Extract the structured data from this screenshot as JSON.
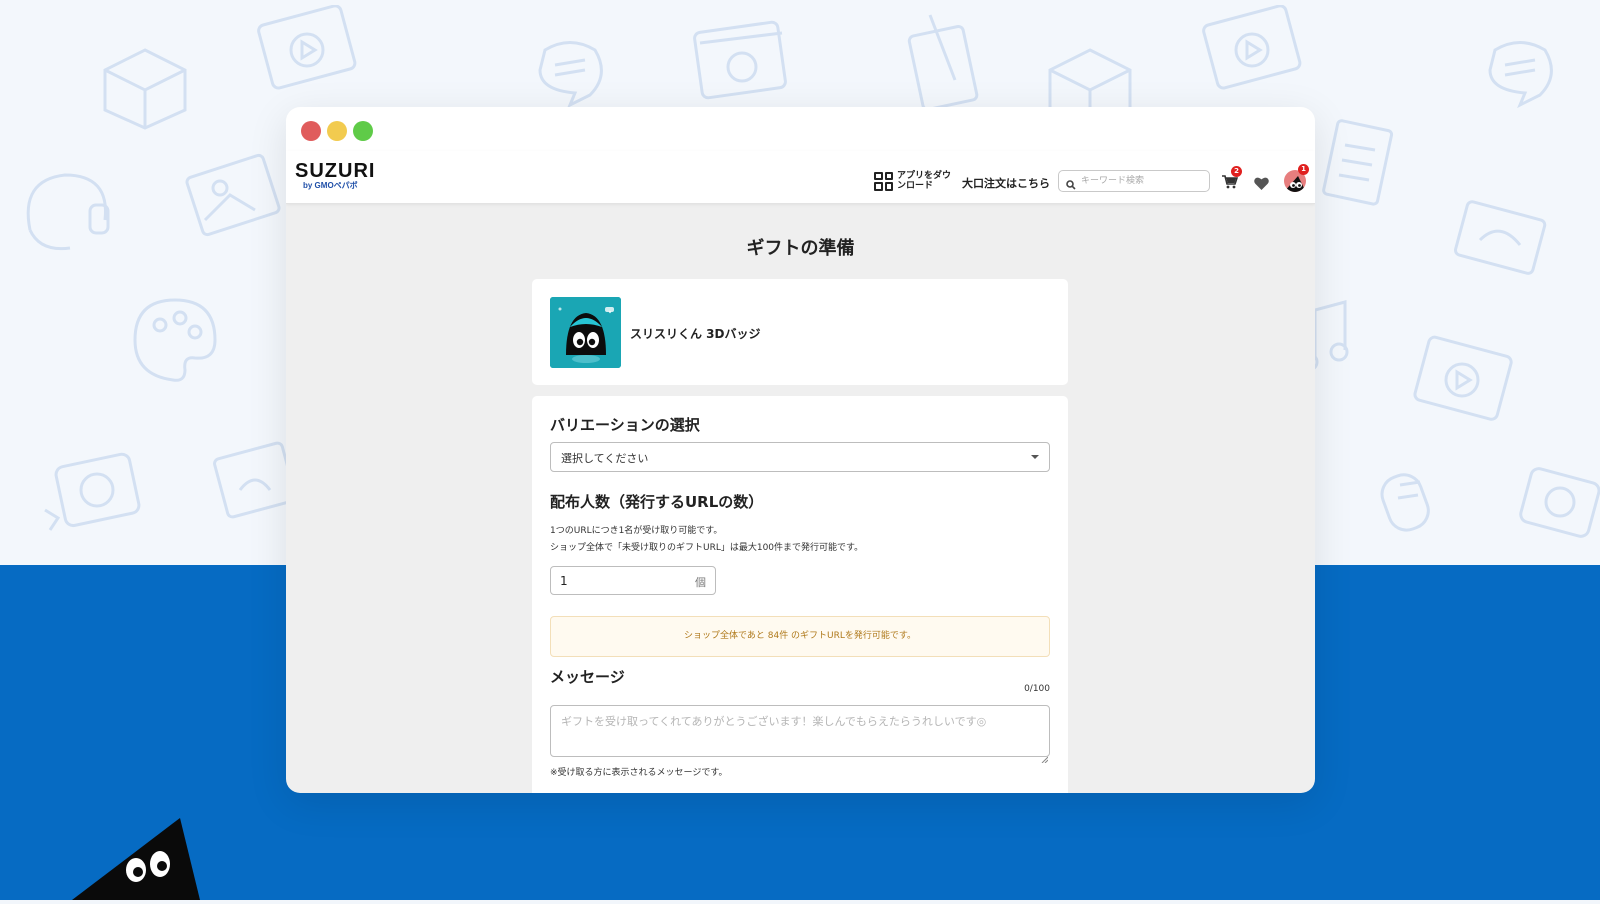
{
  "header": {
    "logo": "SUZURI",
    "logo_sub": "by GMOペパボ",
    "app_download": "アプリをダウンロード",
    "bulk_order": "大口注文はこちら",
    "search_placeholder": "キーワード検索",
    "cart_badge": "2",
    "avatar_badge": "1"
  },
  "page": {
    "title": "ギフトの準備"
  },
  "product": {
    "name": "スリスリくん 3Dバッジ"
  },
  "variation": {
    "label": "バリエーションの選択",
    "selected": "選択してください"
  },
  "recipients": {
    "label": "配布人数（発行するURLの数）",
    "help_line1": "1つのURLにつき1名が受け取り可能です。",
    "help_line2": "ショップ全体で「未受け取りのギフトURL」は最大100件まで発行可能です。",
    "value": "1",
    "unit": "個",
    "notice": "ショップ全体であと 84件 のギフトURLを発行可能です。"
  },
  "message": {
    "label": "メッセージ",
    "counter": "0/100",
    "placeholder": "ギフトを受け取ってくれてありがとうございます！楽しんでもらえたらうれしいです◎",
    "note": "※受け取る方に表示されるメッセージです。"
  },
  "colors": {
    "bottom_band": "#066bc3",
    "window_bg": "#efefef",
    "notice_text": "#b07a1c",
    "badge": "#e0201f"
  },
  "icons": [
    "qr-code-icon",
    "search-icon",
    "cart-icon",
    "heart-icon",
    "avatar",
    "chevron-down-icon"
  ]
}
